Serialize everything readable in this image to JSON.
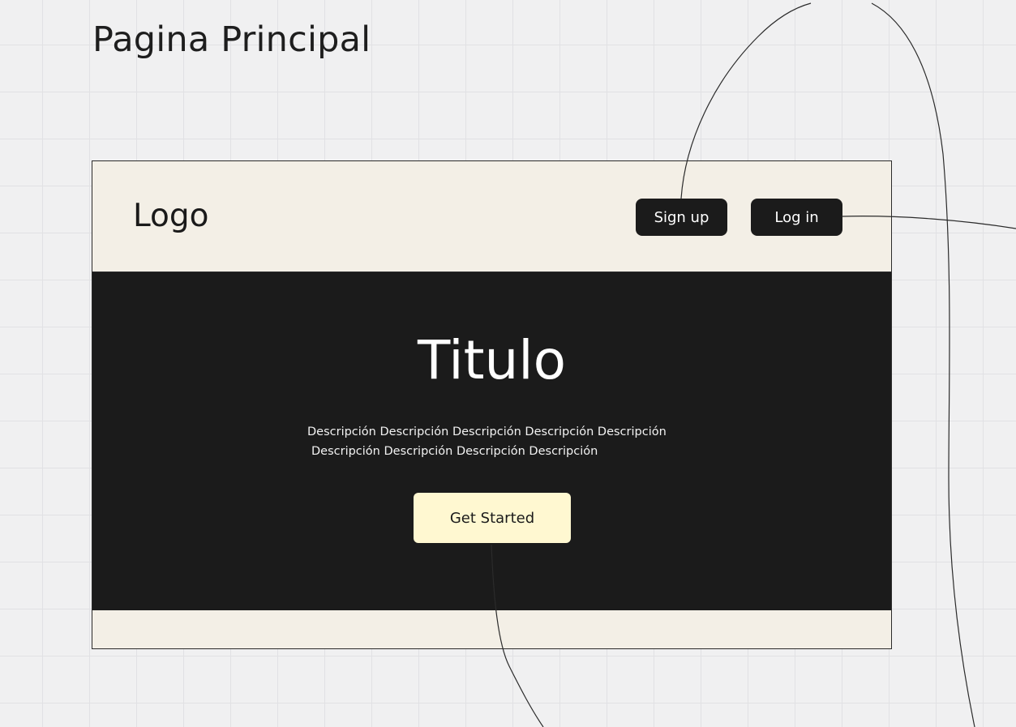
{
  "board": {
    "title": "Pagina Principal"
  },
  "header": {
    "logo": "Logo",
    "signup_label": "Sign up",
    "login_label": "Log in"
  },
  "hero": {
    "title": "Titulo",
    "description_line_1": "Descripción Descripción Descripción Descripción Descripción",
    "description_line_2": "Descripción Descripción Descripción Descripción",
    "cta_label": "Get Started"
  },
  "colors": {
    "canvas_background": "#f0f0f1",
    "frame_background": "#f3efe6",
    "hero_background": "#1b1b1b",
    "button_dark": "#1b1b1b",
    "cta_background": "#fff8d1",
    "connector_stroke": "#2b2b2b"
  }
}
